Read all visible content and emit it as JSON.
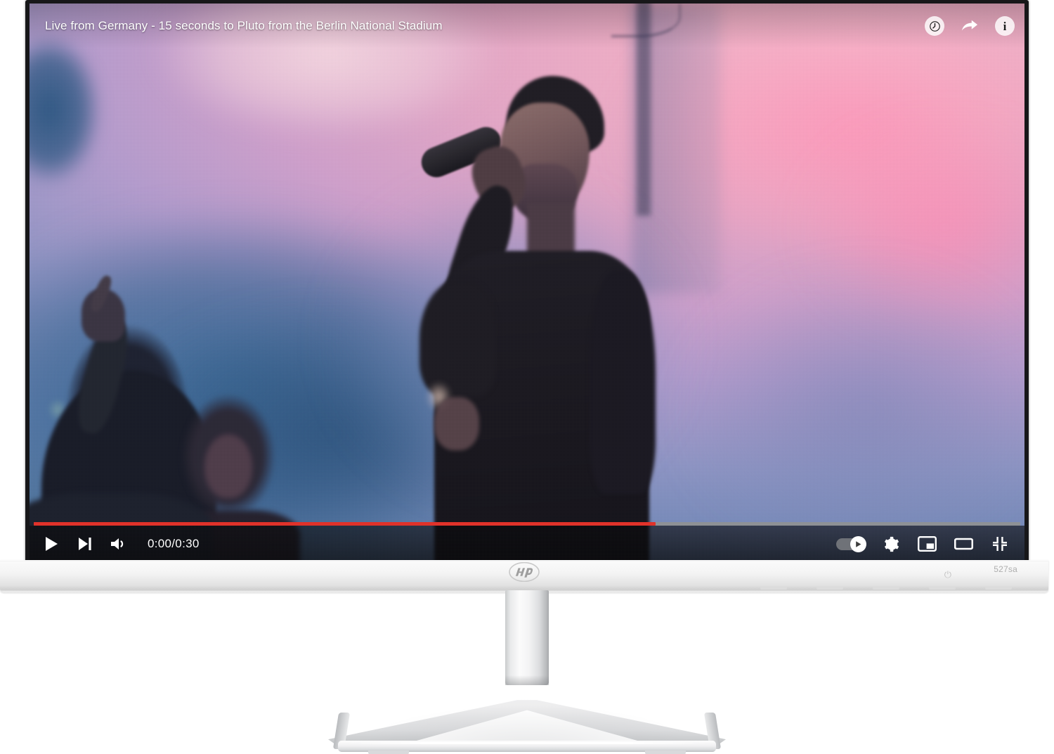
{
  "player": {
    "video_title": "Live from Germany - 15 seconds to Pluto from the Berlin National Stadium",
    "time_display": "0:00/0:30",
    "current_time": "0:00",
    "duration": "0:30",
    "progress_percent": 63,
    "progress_color": "#e0322a",
    "track_color": "#8e9196",
    "autoplay_on": true,
    "title_actions": [
      {
        "name": "watch-later-icon",
        "label": "Watch later"
      },
      {
        "name": "share-icon",
        "label": "Share"
      },
      {
        "name": "info-icon",
        "label": "i"
      }
    ],
    "left_controls": [
      {
        "name": "play-button",
        "label": "Play"
      },
      {
        "name": "next-button",
        "label": "Next"
      },
      {
        "name": "volume-button",
        "label": "Volume"
      }
    ],
    "right_controls": [
      {
        "name": "autoplay-toggle",
        "label": "Autoplay"
      },
      {
        "name": "settings-button",
        "label": "Settings"
      },
      {
        "name": "miniplayer-button",
        "label": "Miniplayer"
      },
      {
        "name": "theater-button",
        "label": "Theater mode"
      },
      {
        "name": "fullscreen-button",
        "label": "Full screen"
      }
    ]
  },
  "monitor": {
    "brand": "hp",
    "model": "527sa",
    "power_symbol": "⏻",
    "bezel_color": "#f4f4f4",
    "frame_color": "#171719"
  }
}
